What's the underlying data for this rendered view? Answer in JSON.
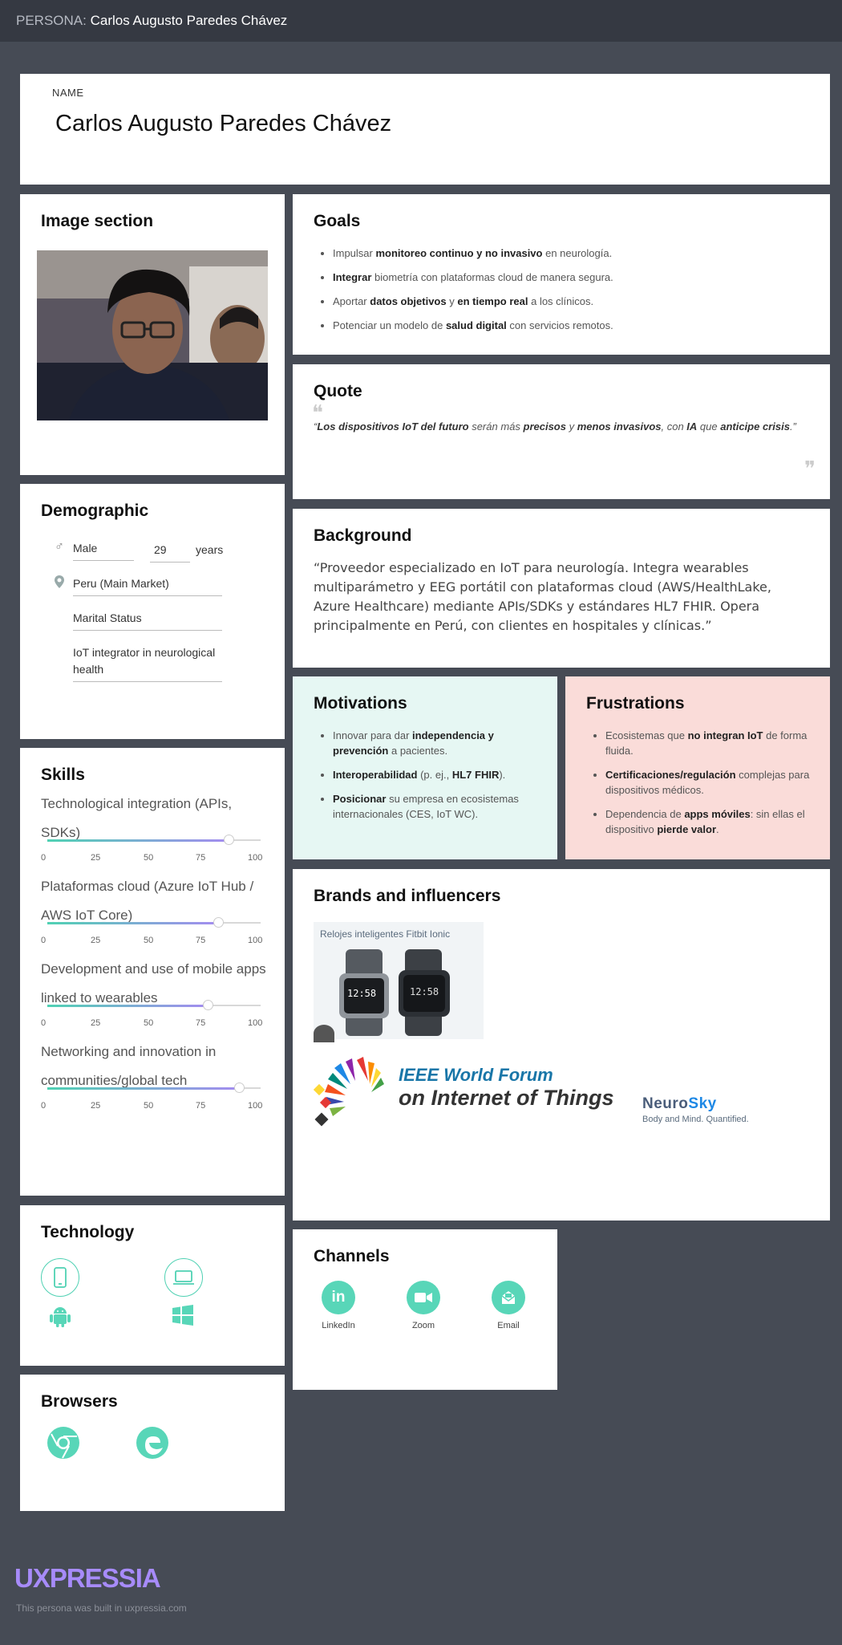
{
  "topbar": {
    "prefix": "PERSONA:",
    "name": "Carlos Augusto Paredes Chávez"
  },
  "name_card": {
    "label": "NAME",
    "value": "Carlos Augusto Paredes Chávez"
  },
  "image_section": {
    "title": "Image section"
  },
  "goals": {
    "title": "Goals",
    "items": [
      [
        "Impulsar ",
        "monitoreo continuo y no invasivo",
        " en neurología."
      ],
      [
        "",
        "Integrar",
        " biometría con plataformas cloud de manera segura."
      ],
      [
        "Aportar ",
        "datos objetivos",
        " y ",
        "en tiempo real",
        " a los clínicos."
      ],
      [
        "Potenciar un modelo de ",
        "salud digital",
        " con servicios remotos."
      ]
    ]
  },
  "quote": {
    "title": "Quote",
    "text": "“Los dispositivos IoT del futuro serán más precisos y menos invasivos, con IA que anticipe crisis.”"
  },
  "background": {
    "title": "Background",
    "text": "“Proveedor especializado en IoT para neurología. Integra wearables multiparámetro y EEG portátil con plataformas cloud (AWS/HealthLake, Azure Healthcare) mediante APIs/SDKs y estándares HL7 FHIR. Opera principalmente en Perú, con clientes en hospitales y clínicas.”"
  },
  "demographic": {
    "title": "Demographic",
    "gender": "Male",
    "age": "29",
    "age_unit": "years",
    "location": "Peru (Main Market)",
    "marital": "Marital Status",
    "occupation": "IoT integrator in neurological health"
  },
  "motivations": {
    "title": "Motivations",
    "color": "#e6f7f3",
    "items": [
      [
        "Innovar para dar ",
        "independencia y prevención",
        " a pacientes."
      ],
      [
        "",
        "Interoperabilidad",
        " (p. ej., ",
        "HL7 FHIR",
        ")."
      ],
      [
        "",
        "Posicionar",
        " su empresa en ecosistemas internacionales (CES, IoT WC)."
      ]
    ]
  },
  "frustrations": {
    "title": "Frustrations",
    "color": "#fadcd9",
    "items": [
      [
        "Ecosistemas que ",
        "no integran IoT",
        " de forma fluida."
      ],
      [
        "",
        "Certificaciones/regulación",
        " complejas para dispositivos médicos."
      ],
      [
        "Dependencia de ",
        "apps móviles",
        ": sin ellas el dispositivo ",
        "pierde valor",
        "."
      ]
    ]
  },
  "skills": {
    "title": "Skills",
    "ticks": [
      "0",
      "25",
      "50",
      "75",
      "100"
    ],
    "items": [
      {
        "label": "Technological integration (APIs, SDKs)",
        "value": 85
      },
      {
        "label": "Plataformas cloud (Azure IoT Hub / AWS IoT Core)",
        "value": 80
      },
      {
        "label": "Development and use of mobile apps linked to wearables",
        "value": 75
      },
      {
        "label": "Networking and innovation in communities/global tech",
        "value": 90
      }
    ]
  },
  "brands": {
    "title": "Brands and influencers",
    "fitbit_caption": "Relojes inteligentes Fitbit Ionic",
    "watch_time": "12:58",
    "ieee_line1": "IEEE World Forum",
    "ieee_line2": "on Internet of Things",
    "neurosky_a": "Neuro",
    "neurosky_b": "Sky",
    "neurosky_tag": "Body and Mind. Quantified."
  },
  "technology": {
    "title": "Technology",
    "icons": [
      "smartphone-icon",
      "laptop-icon",
      "android-icon",
      "windows-icon"
    ]
  },
  "channels": {
    "title": "Channels",
    "items": [
      "LinkedIn",
      "Zoom",
      "Email"
    ]
  },
  "browsers": {
    "title": "Browsers",
    "icons": [
      "chrome-icon",
      "edge-icon"
    ]
  },
  "footer": {
    "logo": "UXPRESSIA",
    "note": "This persona was built in uxpressia.com"
  },
  "colors": {
    "accent": "#58d6b8",
    "brand": "#a78bfa",
    "background": "#464b55"
  }
}
